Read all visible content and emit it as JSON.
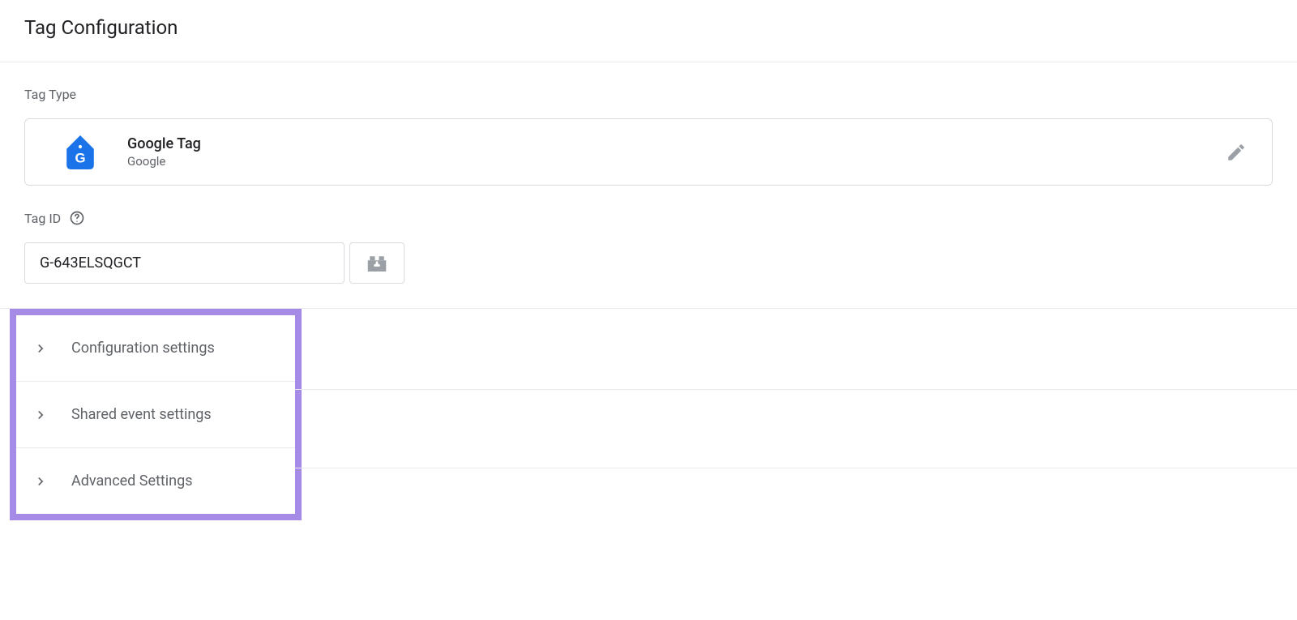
{
  "header": {
    "title": "Tag Configuration"
  },
  "tag_type": {
    "label": "Tag Type",
    "name": "Google Tag",
    "vendor": "Google"
  },
  "tag_id": {
    "label": "Tag ID",
    "value": "G-643ELSQGCT"
  },
  "expandable": {
    "config_settings": "Configuration settings",
    "shared_event_settings": "Shared event settings",
    "advanced_settings": "Advanced Settings"
  }
}
